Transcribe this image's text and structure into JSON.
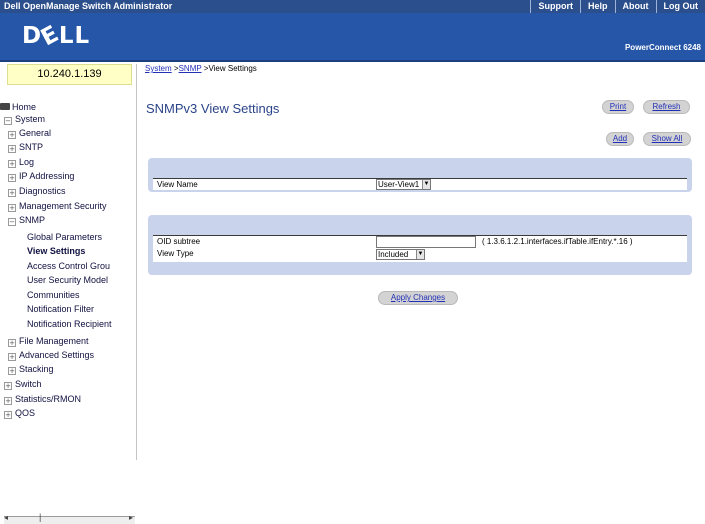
{
  "topbar": {
    "title": "Dell OpenManage Switch Administrator",
    "links": [
      "Support",
      "Help",
      "About",
      "Log Out"
    ]
  },
  "banner": {
    "logo_text": "DELL",
    "model": "PowerConnect 6248"
  },
  "sidebar": {
    "ip_address": "10.240.1.139",
    "tree": [
      {
        "label": "Home",
        "icon": "home-icon"
      },
      {
        "label": "System",
        "icon": "minus-box-icon"
      },
      {
        "label": "General",
        "icon": "plus-box-icon"
      },
      {
        "label": "SNTP",
        "icon": "plus-box-icon"
      },
      {
        "label": "Log",
        "icon": "plus-box-icon"
      },
      {
        "label": "IP Addressing",
        "icon": "plus-box-icon"
      },
      {
        "label": "Diagnostics",
        "icon": "plus-box-icon"
      },
      {
        "label": "Management Security",
        "icon": "plus-box-icon"
      },
      {
        "label": "SNMP",
        "icon": "minus-box-icon"
      },
      {
        "label": "Global Parameters",
        "icon": ""
      },
      {
        "label": "View Settings",
        "icon": "",
        "selected": true
      },
      {
        "label": "Access Control Grou",
        "icon": ""
      },
      {
        "label": "User Security Model",
        "icon": ""
      },
      {
        "label": "Communities",
        "icon": ""
      },
      {
        "label": "Notification Filter",
        "icon": ""
      },
      {
        "label": "Notification Recipient",
        "icon": ""
      },
      {
        "label": "File Management",
        "icon": "plus-box-icon"
      },
      {
        "label": "Advanced Settings",
        "icon": "plus-box-icon"
      },
      {
        "label": "Stacking",
        "icon": "plus-box-icon"
      },
      {
        "label": "Switch",
        "icon": "plus-box-icon"
      },
      {
        "label": "Statistics/RMON",
        "icon": "plus-box-icon"
      },
      {
        "label": "QOS",
        "icon": "plus-box-icon"
      }
    ]
  },
  "breadcrumb": {
    "system": "System",
    "sep1": " >",
    "snmp": "SNMP",
    "sep2": " >",
    "current": "View Settings"
  },
  "main": {
    "title": "SNMPv3 View Settings",
    "buttons": {
      "print": "Print",
      "refresh": "Refresh",
      "add": "Add",
      "show_all": "Show All",
      "apply": "Apply Changes"
    },
    "view_name": {
      "label": "View Name",
      "value": "User-View1"
    },
    "oid_subtree": {
      "label": "OID subtree",
      "value": "",
      "hint": "( 1.3.6.1.2.1.interfaces.ifTable.ifEntry.*.16 )"
    },
    "view_type": {
      "label": "View Type",
      "value": "Included"
    }
  },
  "colors": {
    "topbar": "#2b4e8c",
    "banner": "#2656a8",
    "panel": "#cad3ec",
    "title": "#2c458a",
    "link": "#2230b8"
  }
}
